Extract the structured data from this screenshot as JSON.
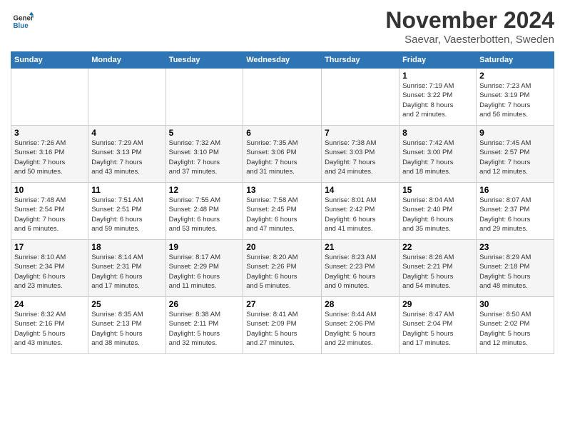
{
  "header": {
    "logo_line1": "General",
    "logo_line2": "Blue",
    "month_title": "November 2024",
    "location": "Saevar, Vaesterbotten, Sweden"
  },
  "weekdays": [
    "Sunday",
    "Monday",
    "Tuesday",
    "Wednesday",
    "Thursday",
    "Friday",
    "Saturday"
  ],
  "weeks": [
    [
      {
        "day": "",
        "info": ""
      },
      {
        "day": "",
        "info": ""
      },
      {
        "day": "",
        "info": ""
      },
      {
        "day": "",
        "info": ""
      },
      {
        "day": "",
        "info": ""
      },
      {
        "day": "1",
        "info": "Sunrise: 7:19 AM\nSunset: 3:22 PM\nDaylight: 8 hours\nand 2 minutes."
      },
      {
        "day": "2",
        "info": "Sunrise: 7:23 AM\nSunset: 3:19 PM\nDaylight: 7 hours\nand 56 minutes."
      }
    ],
    [
      {
        "day": "3",
        "info": "Sunrise: 7:26 AM\nSunset: 3:16 PM\nDaylight: 7 hours\nand 50 minutes."
      },
      {
        "day": "4",
        "info": "Sunrise: 7:29 AM\nSunset: 3:13 PM\nDaylight: 7 hours\nand 43 minutes."
      },
      {
        "day": "5",
        "info": "Sunrise: 7:32 AM\nSunset: 3:10 PM\nDaylight: 7 hours\nand 37 minutes."
      },
      {
        "day": "6",
        "info": "Sunrise: 7:35 AM\nSunset: 3:06 PM\nDaylight: 7 hours\nand 31 minutes."
      },
      {
        "day": "7",
        "info": "Sunrise: 7:38 AM\nSunset: 3:03 PM\nDaylight: 7 hours\nand 24 minutes."
      },
      {
        "day": "8",
        "info": "Sunrise: 7:42 AM\nSunset: 3:00 PM\nDaylight: 7 hours\nand 18 minutes."
      },
      {
        "day": "9",
        "info": "Sunrise: 7:45 AM\nSunset: 2:57 PM\nDaylight: 7 hours\nand 12 minutes."
      }
    ],
    [
      {
        "day": "10",
        "info": "Sunrise: 7:48 AM\nSunset: 2:54 PM\nDaylight: 7 hours\nand 6 minutes."
      },
      {
        "day": "11",
        "info": "Sunrise: 7:51 AM\nSunset: 2:51 PM\nDaylight: 6 hours\nand 59 minutes."
      },
      {
        "day": "12",
        "info": "Sunrise: 7:55 AM\nSunset: 2:48 PM\nDaylight: 6 hours\nand 53 minutes."
      },
      {
        "day": "13",
        "info": "Sunrise: 7:58 AM\nSunset: 2:45 PM\nDaylight: 6 hours\nand 47 minutes."
      },
      {
        "day": "14",
        "info": "Sunrise: 8:01 AM\nSunset: 2:42 PM\nDaylight: 6 hours\nand 41 minutes."
      },
      {
        "day": "15",
        "info": "Sunrise: 8:04 AM\nSunset: 2:40 PM\nDaylight: 6 hours\nand 35 minutes."
      },
      {
        "day": "16",
        "info": "Sunrise: 8:07 AM\nSunset: 2:37 PM\nDaylight: 6 hours\nand 29 minutes."
      }
    ],
    [
      {
        "day": "17",
        "info": "Sunrise: 8:10 AM\nSunset: 2:34 PM\nDaylight: 6 hours\nand 23 minutes."
      },
      {
        "day": "18",
        "info": "Sunrise: 8:14 AM\nSunset: 2:31 PM\nDaylight: 6 hours\nand 17 minutes."
      },
      {
        "day": "19",
        "info": "Sunrise: 8:17 AM\nSunset: 2:29 PM\nDaylight: 6 hours\nand 11 minutes."
      },
      {
        "day": "20",
        "info": "Sunrise: 8:20 AM\nSunset: 2:26 PM\nDaylight: 6 hours\nand 5 minutes."
      },
      {
        "day": "21",
        "info": "Sunrise: 8:23 AM\nSunset: 2:23 PM\nDaylight: 6 hours\nand 0 minutes."
      },
      {
        "day": "22",
        "info": "Sunrise: 8:26 AM\nSunset: 2:21 PM\nDaylight: 5 hours\nand 54 minutes."
      },
      {
        "day": "23",
        "info": "Sunrise: 8:29 AM\nSunset: 2:18 PM\nDaylight: 5 hours\nand 48 minutes."
      }
    ],
    [
      {
        "day": "24",
        "info": "Sunrise: 8:32 AM\nSunset: 2:16 PM\nDaylight: 5 hours\nand 43 minutes."
      },
      {
        "day": "25",
        "info": "Sunrise: 8:35 AM\nSunset: 2:13 PM\nDaylight: 5 hours\nand 38 minutes."
      },
      {
        "day": "26",
        "info": "Sunrise: 8:38 AM\nSunset: 2:11 PM\nDaylight: 5 hours\nand 32 minutes."
      },
      {
        "day": "27",
        "info": "Sunrise: 8:41 AM\nSunset: 2:09 PM\nDaylight: 5 hours\nand 27 minutes."
      },
      {
        "day": "28",
        "info": "Sunrise: 8:44 AM\nSunset: 2:06 PM\nDaylight: 5 hours\nand 22 minutes."
      },
      {
        "day": "29",
        "info": "Sunrise: 8:47 AM\nSunset: 2:04 PM\nDaylight: 5 hours\nand 17 minutes."
      },
      {
        "day": "30",
        "info": "Sunrise: 8:50 AM\nSunset: 2:02 PM\nDaylight: 5 hours\nand 12 minutes."
      }
    ]
  ]
}
